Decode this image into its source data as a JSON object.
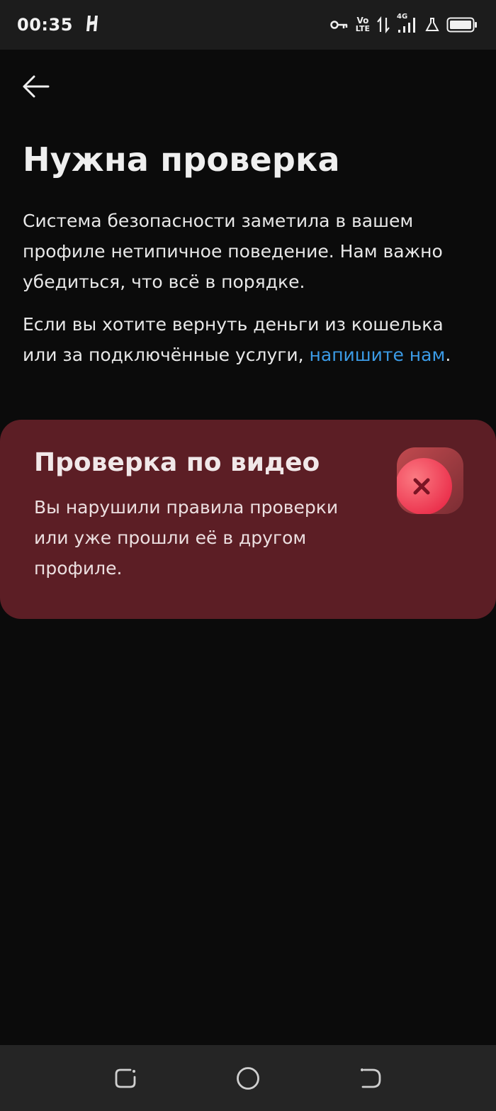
{
  "status_bar": {
    "time": "00:35",
    "volte_top": "Vo",
    "volte_bottom": "LTE",
    "network": "4G",
    "icons": [
      "h-app-icon",
      "vpn-key-icon",
      "volte-icon",
      "data-arrows-icon",
      "signal-icon",
      "lab-icon",
      "battery-icon"
    ]
  },
  "header": {
    "back_icon": "arrow-left-icon"
  },
  "main": {
    "title": "Нужна проверка",
    "paragraph1": "Система безопасности заметила в вашем профиле нетипичное поведение. Нам важно убедиться, что всё в порядке.",
    "paragraph2_prefix": "Если вы хотите вернуть деньги из кошелька или за подключённые услуги, ",
    "paragraph2_link": "напишите нам",
    "paragraph2_suffix": "."
  },
  "card": {
    "title": "Проверка по видео",
    "text": "Вы нарушили правила проверки или уже прошли её в другом профиле.",
    "icon": "error-x-icon",
    "colors": {
      "background": "#5c1e25",
      "icon_accent": "#f0435a"
    }
  },
  "nav_bar": {
    "icons": [
      "recents-icon",
      "home-icon",
      "back-nav-icon"
    ]
  },
  "colors": {
    "background": "#0b0b0b",
    "link": "#3b9be6"
  }
}
